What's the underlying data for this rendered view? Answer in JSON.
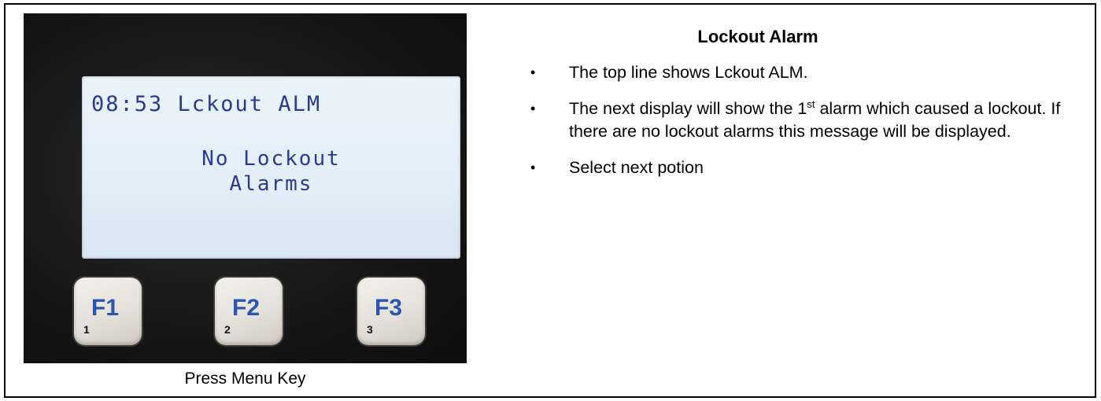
{
  "device": {
    "lcd": {
      "line1": "08:53 Lckout ALM",
      "line2": "No Lockout",
      "line3": "Alarms"
    },
    "keys": [
      {
        "label": "F1",
        "number": "1"
      },
      {
        "label": "F2",
        "number": "2"
      },
      {
        "label": "F3",
        "number": "3"
      }
    ],
    "caption": "Press Menu Key"
  },
  "panel": {
    "title": "Lockout Alarm",
    "bullets": [
      {
        "text": "The top line shows Lckout ALM."
      },
      {
        "before": "The next display will show the 1",
        "sup": "st",
        "after": " alarm which caused a lockout. If there are no lockout alarms this message will be displayed."
      },
      {
        "text": "Select next potion"
      }
    ],
    "bullet_glyph": "•"
  },
  "colors": {
    "lcd_background": "#e6f1fa",
    "lcd_text": "#2a3a8f",
    "key_label": "#2a56b0",
    "bezel": "#161616"
  }
}
